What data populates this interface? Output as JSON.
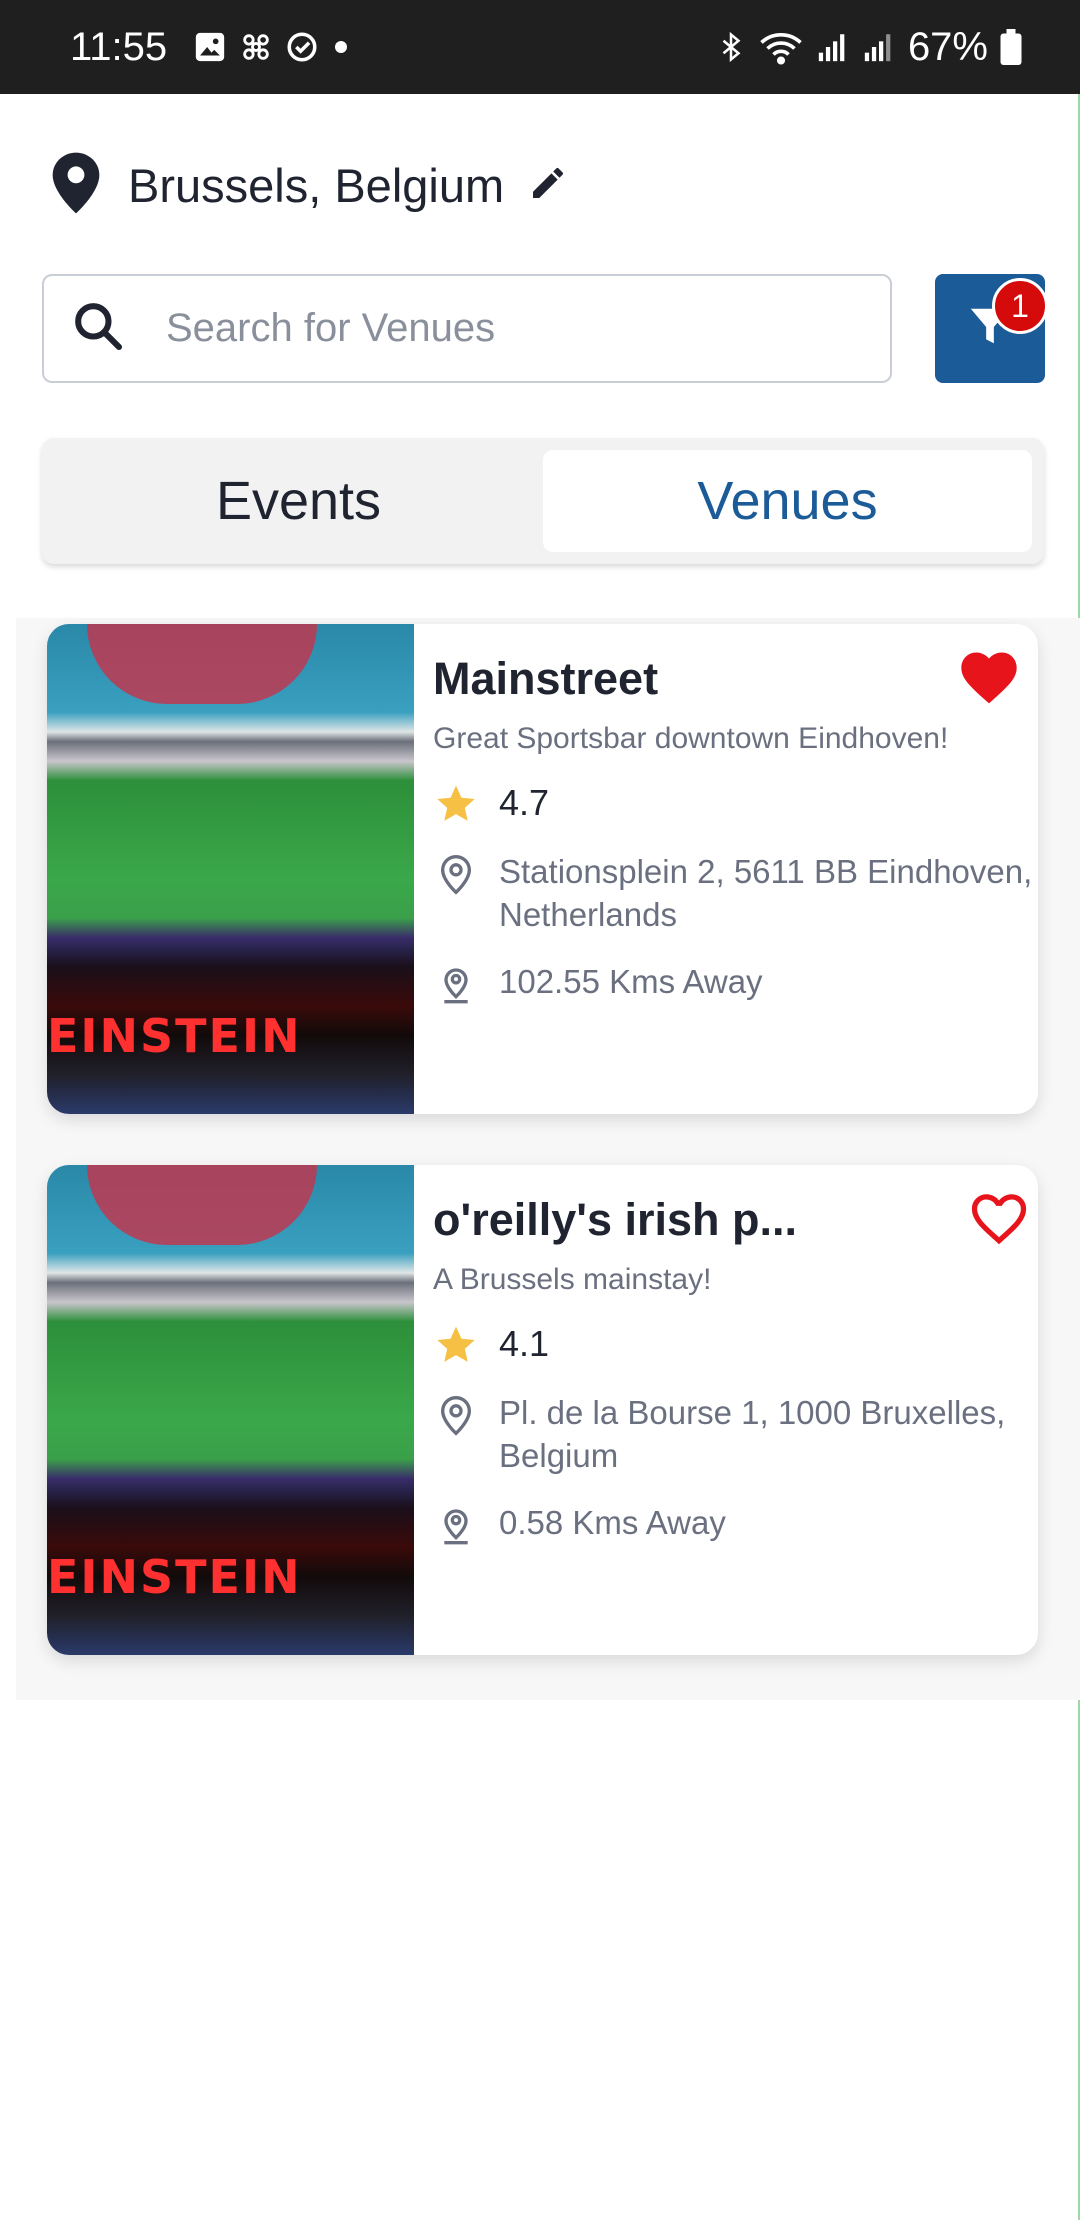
{
  "status_bar": {
    "time": "11:55",
    "battery": "67%",
    "left_icons": [
      "image-icon",
      "fan-icon",
      "check-circle-icon",
      "dot-icon"
    ],
    "right_icons": [
      "bluetooth-icon",
      "wifi-icon",
      "signal-icon",
      "signal-icon",
      "battery-icon"
    ]
  },
  "location": {
    "label": "Brussels, Belgium",
    "icon": "map-pin-icon",
    "edit_icon": "pencil-icon"
  },
  "search": {
    "placeholder": "Search for Venues",
    "value": ""
  },
  "filter": {
    "badge_count": "1",
    "color": "#1b5c98",
    "badge_color": "#d50b0b"
  },
  "tabs": {
    "events_label": "Events",
    "venues_label": "Venues",
    "selected": "Venues"
  },
  "venues": [
    {
      "name": "Mainstreet",
      "description": "Great Sportsbar downtown Eindhoven!",
      "rating": "4.7",
      "address": "Stationsplein 2, 5611 BB Eindhoven, Netherlands",
      "distance": "102.55 Kms Away",
      "favorite": true
    },
    {
      "name": "o'reilly's irish p...",
      "description": "A Brussels mainstay!",
      "rating": "4.1",
      "address": "Pl. de la Bourse 1, 1000 Bruxelles, Belgium",
      "distance": "0.58 Kms Away",
      "favorite": false
    }
  ],
  "image_sign_text": "EINSTEIN",
  "colors": {
    "accent": "#1b5c98",
    "favorite": "#e8141b",
    "star": "#f5c043"
  }
}
